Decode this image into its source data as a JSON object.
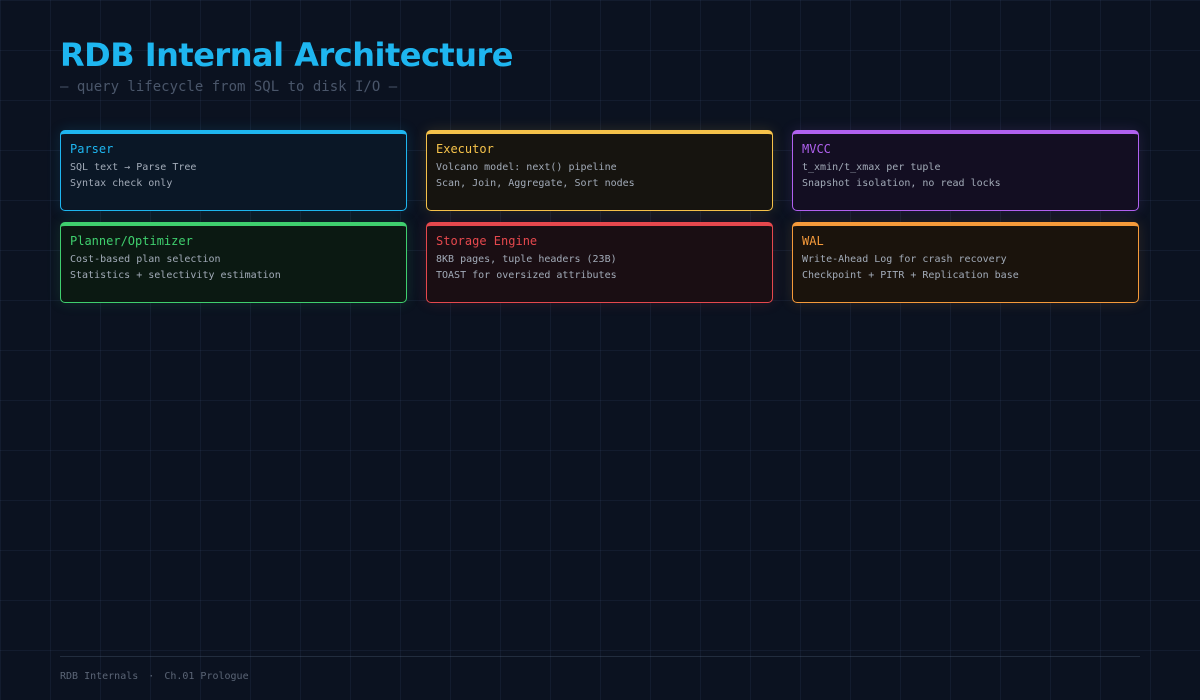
{
  "title": "RDB Internal Architecture",
  "subtitle": "— query lifecycle from SQL to disk I/O —",
  "cards": [
    {
      "title": "Parser",
      "lines": [
        "SQL text → Parse Tree",
        "Syntax check only"
      ],
      "accent": "#1eb6f0",
      "bg": "#0a1726"
    },
    {
      "title": "Executor",
      "lines": [
        "Volcano model: next() pipeline",
        "Scan, Join, Aggregate, Sort nodes"
      ],
      "accent": "#f5c24a",
      "bg": "#16140f"
    },
    {
      "title": "MVCC",
      "lines": [
        "t_xmin/t_xmax per tuple",
        "Snapshot isolation, no read locks"
      ],
      "accent": "#b061f0",
      "bg": "#130e22"
    },
    {
      "title": "Planner/Optimizer",
      "lines": [
        "Cost-based plan selection",
        "Statistics + selectivity estimation"
      ],
      "accent": "#3fcf6e",
      "bg": "#0b1912"
    },
    {
      "title": "Storage Engine",
      "lines": [
        "8KB pages, tuple headers (23B)",
        "TOAST for oversized attributes"
      ],
      "accent": "#e5484d",
      "bg": "#1a0e13"
    },
    {
      "title": "WAL",
      "lines": [
        "Write-Ahead Log for crash recovery",
        "Checkpoint + PITR + Replication base"
      ],
      "accent": "#f59a3a",
      "bg": "#1a130c"
    }
  ],
  "footer": {
    "series": "RDB Internals",
    "separator": "·",
    "chapter": "Ch.01 Prologue"
  }
}
